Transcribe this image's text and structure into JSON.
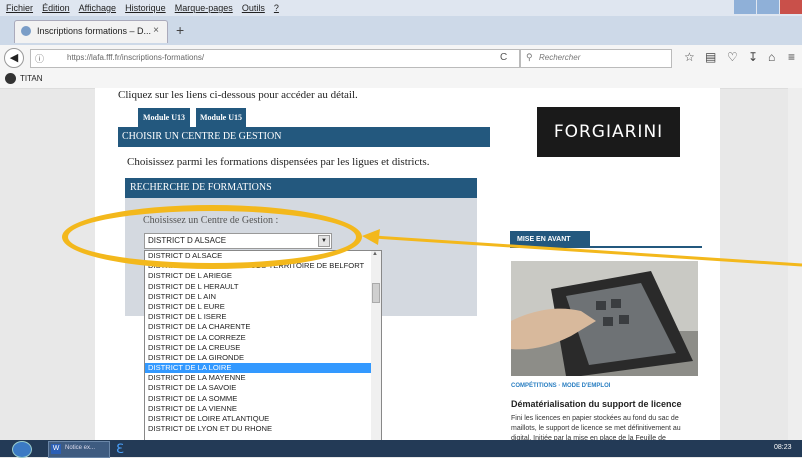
{
  "menu": [
    "Fichier",
    "Édition",
    "Affichage",
    "Historique",
    "Marque-pages",
    "Outils",
    "?"
  ],
  "tab": {
    "title": "Inscriptions formations – D...",
    "close": "×",
    "new": "+"
  },
  "address": {
    "url": "https://lafa.fff.fr/inscriptions-formations/",
    "reload": "C",
    "search_placeholder": "Rechercher"
  },
  "bookmarks": [
    "TITAN"
  ],
  "page": {
    "intro": "Cliquez sur les liens ci-dessous pour accéder au détail.",
    "module_tabs": [
      "Module U13",
      "Module U15"
    ],
    "center_header": "CHOISIR UN CENTRE DE GESTION",
    "choose_text": "Choisissez parmi les formations dispensées par les ligues et districts.",
    "search_header": "RECHERCHE DE FORMATIONS",
    "select_label": "Choisissez un Centre de Gestion :",
    "select_value": "DISTRICT D ALSACE",
    "options": [
      "DISTRICT D ALSACE",
      "DISTRICT DE FOOTBALL DOUBS-TERRITOIRE DE BELFORT",
      "DISTRICT DE L ARIEGE",
      "DISTRICT DE L HERAULT",
      "DISTRICT DE L AIN",
      "DISTRICT DE L EURE",
      "DISTRICT DE L ISERE",
      "DISTRICT DE LA CHARENTE",
      "DISTRICT DE LA CORREZE",
      "DISTRICT DE LA CREUSE",
      "DISTRICT DE LA GIRONDE",
      "DISTRICT DE LA LOIRE",
      "DISTRICT DE LA MAYENNE",
      "DISTRICT DE LA SAVOIE",
      "DISTRICT DE LA SOMME",
      "DISTRICT DE LA VIENNE",
      "DISTRICT DE LOIRE ATLANTIQUE",
      "DISTRICT DE LYON ET DU RHONE"
    ],
    "selected_index": 11
  },
  "sidebar": {
    "brand": "FORGIARINI",
    "mise_en_avant": "MISE EN AVANT",
    "category": "COMPÉTITIONS · MODE D'EMPLOI",
    "article_title": "Dématérialisation du support de licence",
    "article_body": "Fini les licences en papier stockées au fond du sac de maillots, le support de licence se met définitivement au digital. Initiée par la mise en place de la Feuille de"
  },
  "taskbar": {
    "word_label": "Notice ex...",
    "clock": "08:23"
  },
  "colors": {
    "header_blue": "#23587e",
    "annotation": "#f3b81c",
    "selected": "#3399ff"
  }
}
